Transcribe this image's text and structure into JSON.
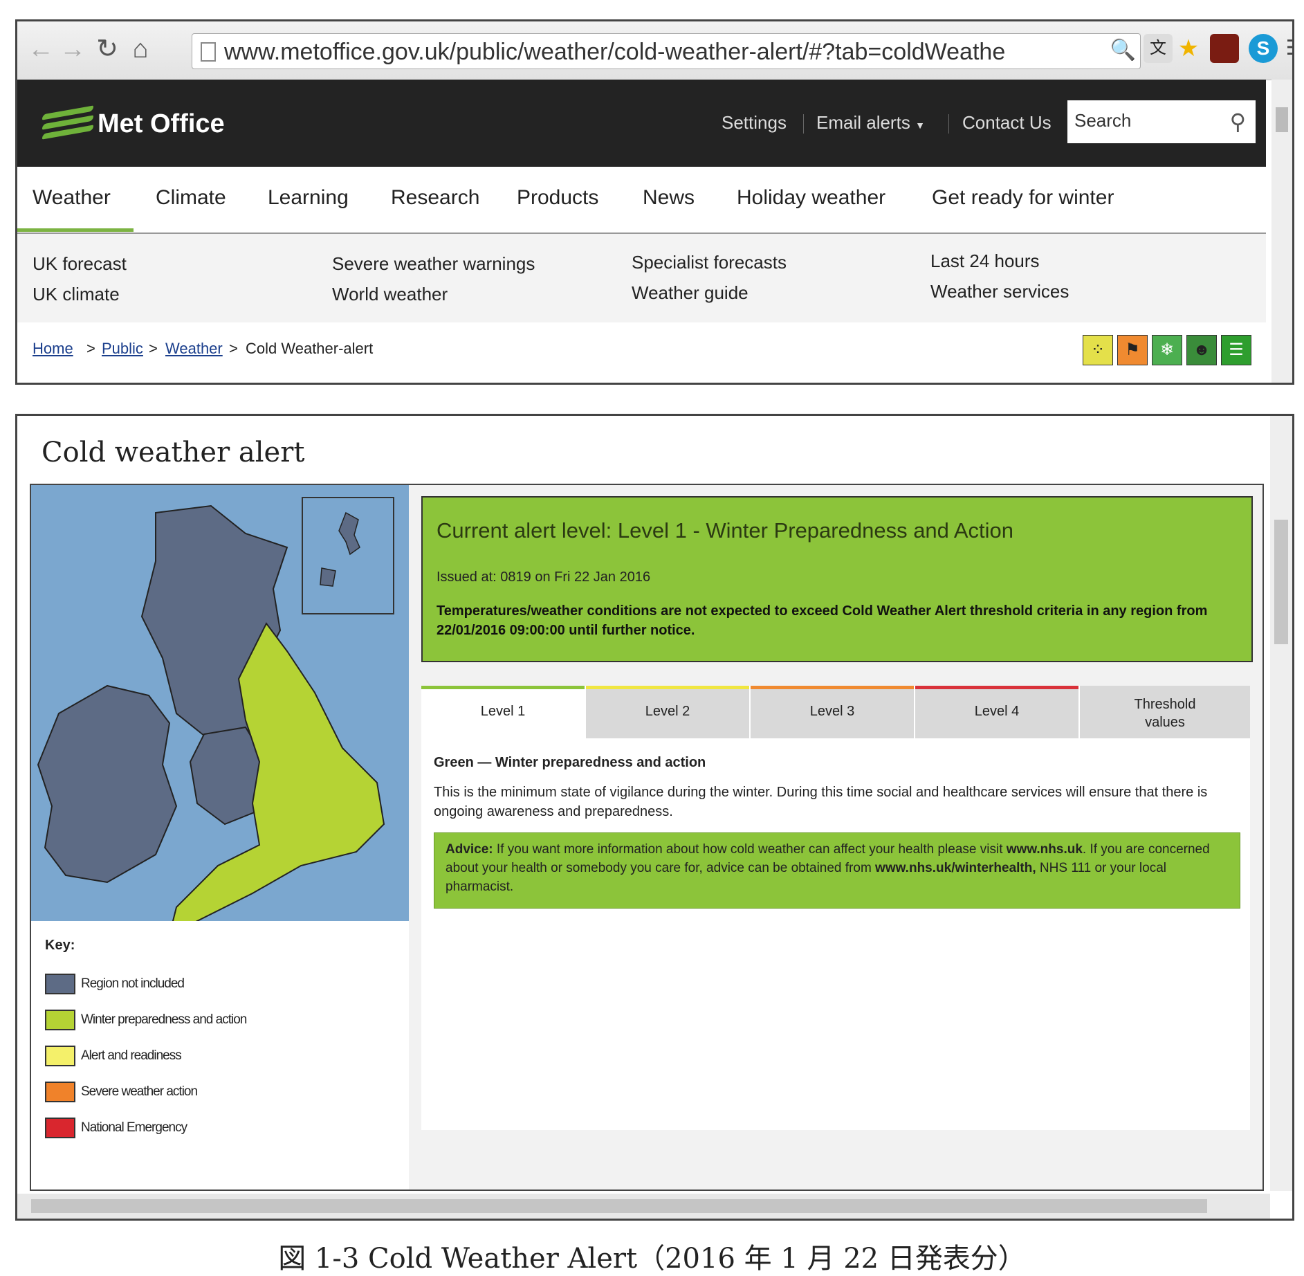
{
  "browser": {
    "url": "www.metoffice.gov.uk/public/weather/cold-weather-alert/#?tab=coldWeathe",
    "back_icon": "arrow-left-icon",
    "forward_icon": "arrow-right-icon",
    "reload_icon": "reload-icon",
    "home_icon": "home-icon"
  },
  "header": {
    "logo_text": "Met Office",
    "links": [
      "Settings",
      "Email alerts",
      "Contact Us"
    ],
    "search_placeholder": "Search"
  },
  "main_nav": [
    "Weather",
    "Climate",
    "Learning",
    "Research",
    "Products",
    "News",
    "Holiday weather",
    "Get ready for winter"
  ],
  "sub_nav": [
    [
      "UK forecast",
      "UK climate"
    ],
    [
      "Severe weather warnings",
      "World weather"
    ],
    [
      "Specialist forecasts",
      "Weather guide"
    ],
    [
      "Last 24 hours",
      "Weather services"
    ]
  ],
  "breadcrumb": {
    "home": "Home",
    "public": "Public",
    "weather": "Weather",
    "current": "Cold Weather-alert",
    "sep": ">"
  },
  "page": {
    "title": "Cold weather alert"
  },
  "alert": {
    "title": "Current alert level: Level 1 - Winter Preparedness and Action",
    "issued": "Issued at: 0819 on Fri 22 Jan 2016",
    "text": "Temperatures/weather conditions are not expected to exceed Cold Weather Alert threshold criteria in any region from 22/01/2016 09:00:00 until further notice.",
    "color": "#8cc43a"
  },
  "tabs": [
    {
      "label": "Level 1",
      "color": "#8cc43a"
    },
    {
      "label": "Level 2",
      "color": "#f0e641"
    },
    {
      "label": "Level 3",
      "color": "#f08a30"
    },
    {
      "label": "Level 4",
      "color": "#d9323a"
    },
    {
      "label": "Threshold values",
      "color": "#d9d9d9"
    }
  ],
  "level": {
    "heading": "Green — Winter preparedness and action",
    "text": "This is the minimum state of vigilance during the winter. During this time social and healthcare services will ensure that there is ongoing awareness and preparedness.",
    "advice_label": "Advice:",
    "advice_text": " If you want more information about how cold weather can affect your health please visit ",
    "advice_link1": "www.nhs.uk",
    "advice_text2": ". If you are concerned about your health or somebody you care for, advice can be obtained from ",
    "advice_link2": "www.nhs.uk/winterhealth,",
    "advice_text3": " NHS 111 or your local pharmacist."
  },
  "key": {
    "title": "Key:",
    "items": [
      {
        "label": "Region not included",
        "color": "#5d6b85"
      },
      {
        "label": "Winter preparedness and action",
        "color": "#b5d334"
      },
      {
        "label": "Alert and readiness",
        "color": "#f4f06a"
      },
      {
        "label": "Severe weather action",
        "color": "#f0822a"
      },
      {
        "label": "National Emergency",
        "color": "#d9262e"
      }
    ]
  },
  "caption": "図 1-3 Cold Weather Alert（2016 年 1 月 22 日発表分）"
}
